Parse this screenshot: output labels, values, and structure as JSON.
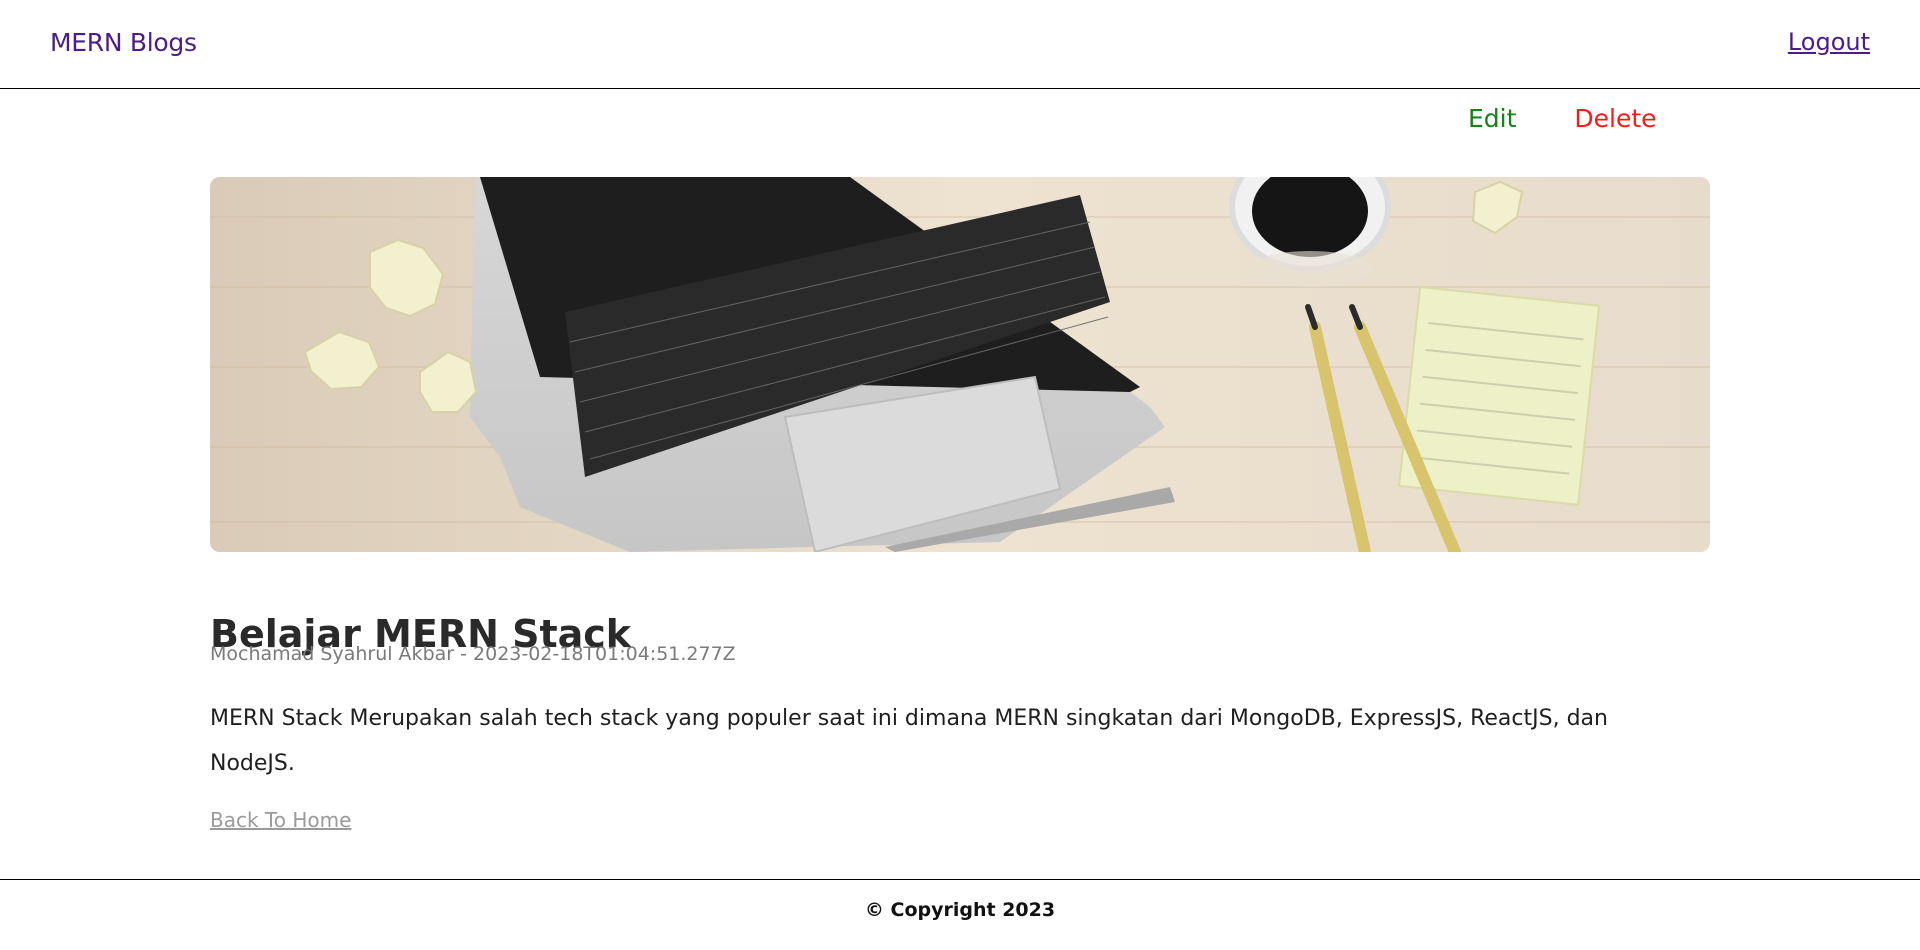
{
  "header": {
    "brand": "MERN Blogs",
    "logout_label": "Logout"
  },
  "post_actions": {
    "edit_label": "Edit",
    "delete_label": "Delete"
  },
  "post": {
    "title": "Belajar MERN Stack",
    "meta": "Mochamad Syahrul Akbar - 2023-02-18T01:04:51.277Z",
    "body": "MERN Stack Merupakan salah tech stack yang populer saat ini dimana MERN singkatan dari MongoDB, ExpressJS, ReactJS, dan NodeJS.",
    "back_label": "Back To Home"
  },
  "footer": {
    "copyright": "© Copyright 2023"
  },
  "colors": {
    "brand": "#4b1d8a",
    "edit": "#168316",
    "delete": "#ff1a1a"
  }
}
